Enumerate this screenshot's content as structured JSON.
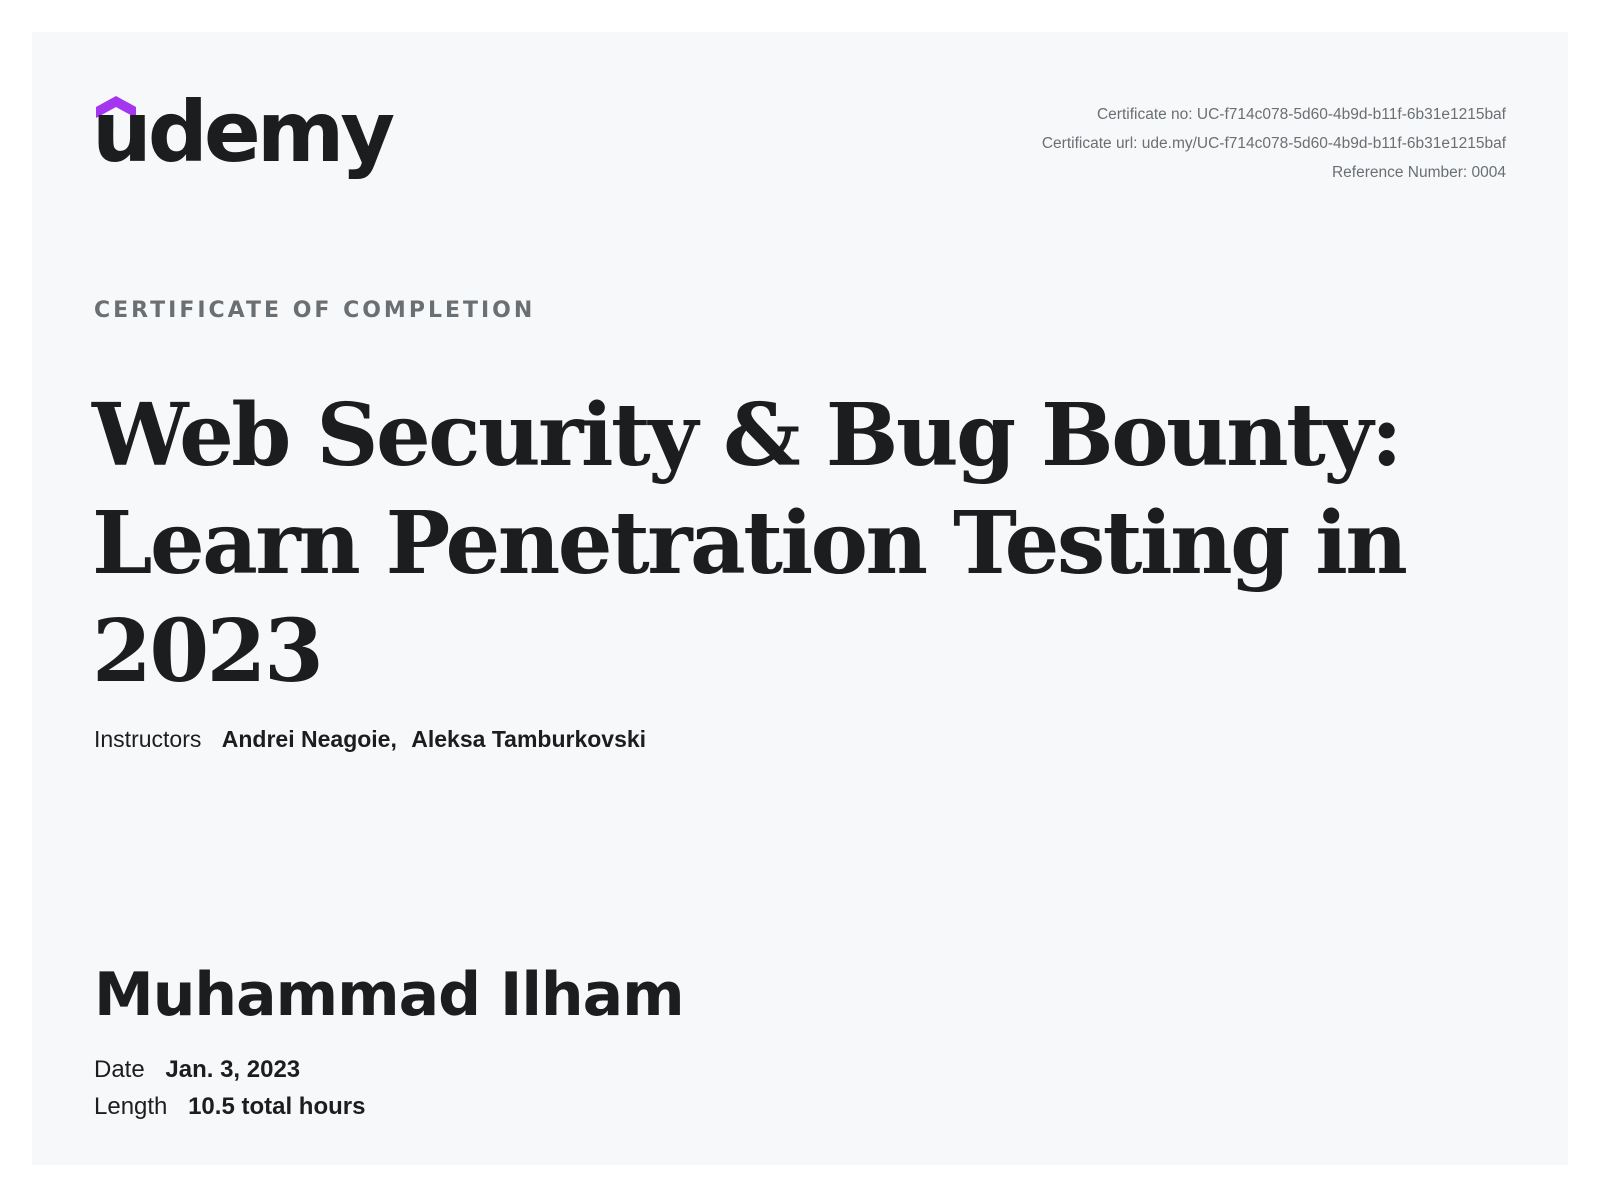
{
  "brand": {
    "logo_text": "udemy",
    "accent_color": "#a435f0"
  },
  "meta": {
    "certificate_no": "Certificate no: UC-f714c078-5d60-4b9d-b11f-6b31e1215baf",
    "certificate_url": "Certificate url: ude.my/UC-f714c078-5d60-4b9d-b11f-6b31e1215baf",
    "reference_number": "Reference Number: 0004"
  },
  "kicker": "CERTIFICATE OF COMPLETION",
  "course": {
    "title_line1": "Web Security & Bug Bounty:",
    "title_line2": "Learn Penetration Testing in",
    "title_line3": "2023"
  },
  "instructors": {
    "label": "Instructors",
    "names": [
      "Andrei Neagoie,",
      "Aleksa Tamburkovski"
    ]
  },
  "recipient": "Muhammad Ilham",
  "details": {
    "date_label": "Date",
    "date_value": "Jan. 3, 2023",
    "length_label": "Length",
    "length_value": "10.5 total hours"
  }
}
